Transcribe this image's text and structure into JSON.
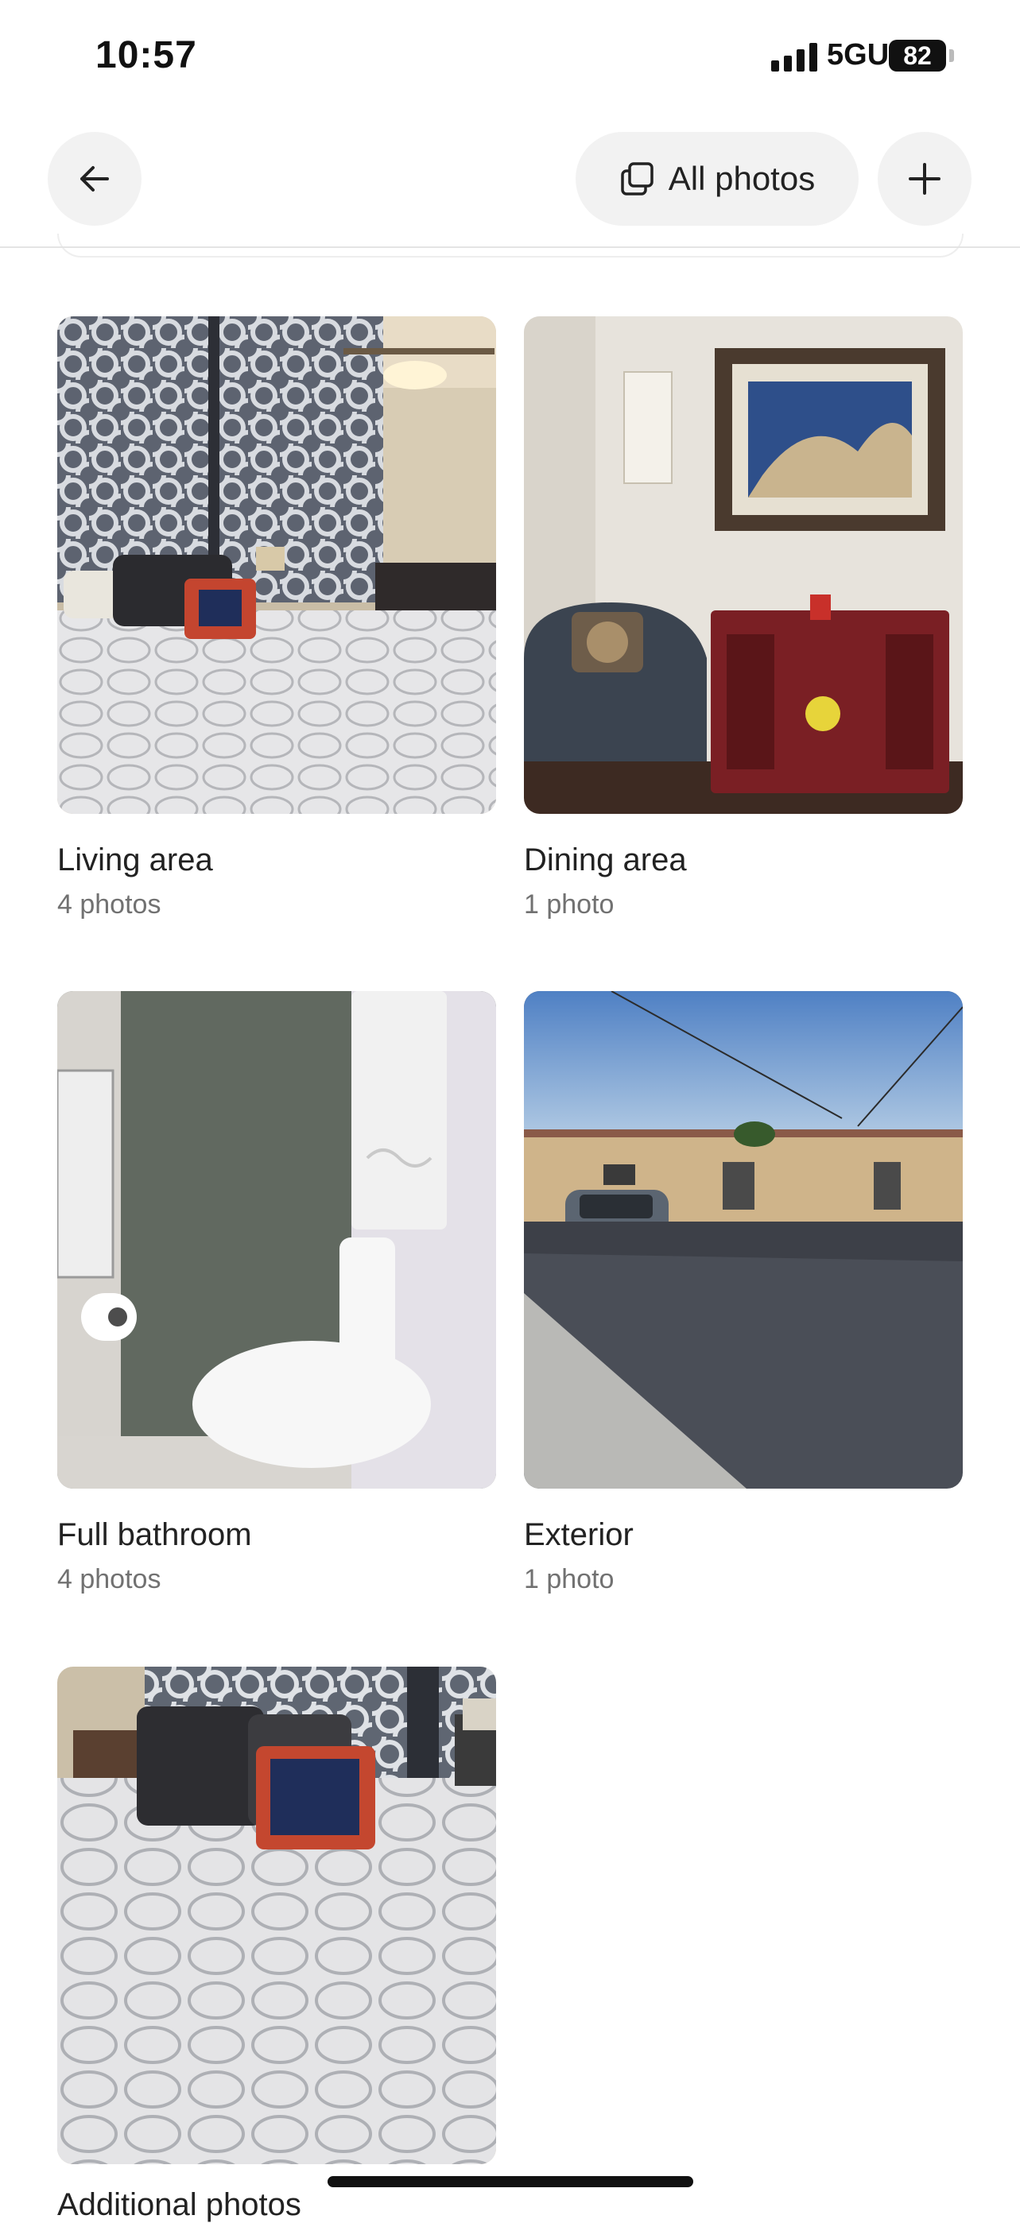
{
  "status_bar": {
    "time": "10:57",
    "network": "5GUC",
    "battery": "82"
  },
  "nav": {
    "back_icon": "arrow-left-icon",
    "all_photos_label": "All photos",
    "all_photos_icon": "photo-stack-icon",
    "add_icon": "plus-icon"
  },
  "categories": [
    {
      "title": "Living area",
      "count": "4 photos"
    },
    {
      "title": "Dining area",
      "count": "1 photo"
    },
    {
      "title": "Full bathroom",
      "count": "4 photos"
    },
    {
      "title": "Exterior",
      "count": "1 photo"
    },
    {
      "title": "Additional photos",
      "count": ""
    }
  ],
  "colors": {
    "text_primary": "#222222",
    "text_secondary": "#717171",
    "button_bg": "#f2f2f2"
  }
}
